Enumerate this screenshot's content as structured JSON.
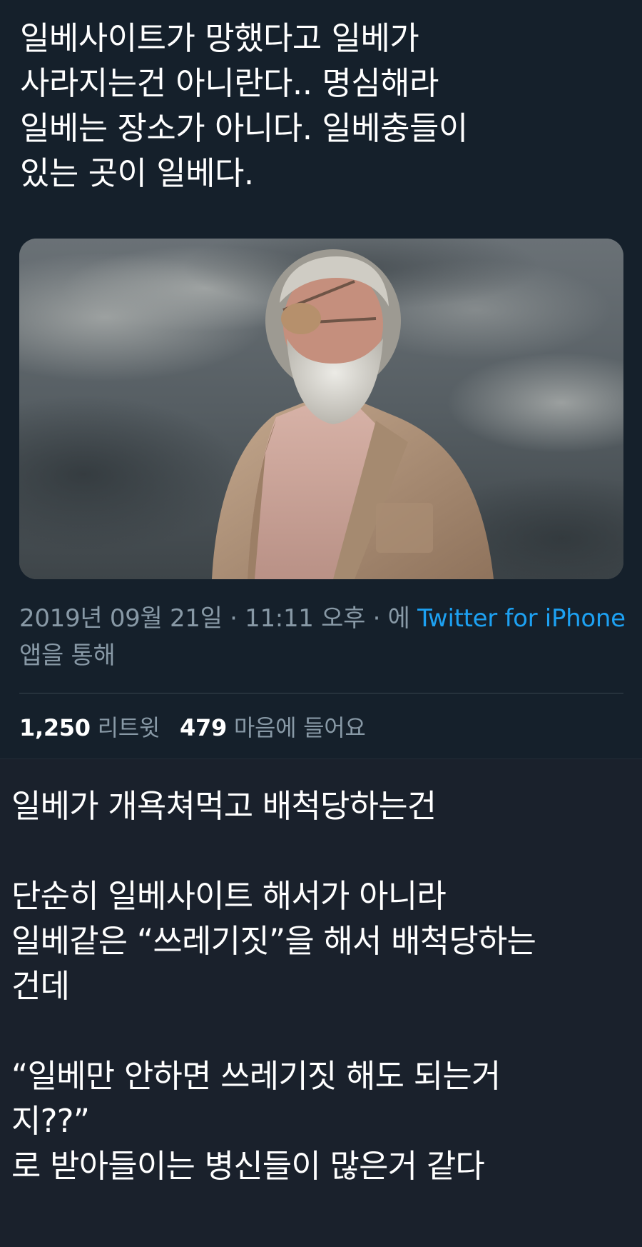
{
  "tweet": {
    "text": "일베사이트가 망했다고 일베가\n사라지는건 아니란다.. 명심해라\n일베는 장소가 아니다. 일베충들이\n있는 곳이 일베다.",
    "media": {
      "icon": "photo-attachment"
    },
    "meta": {
      "timestamp": "2019년 09월 21일 · 11:11 오후 · 에 ",
      "source_link": "Twitter for iPhone",
      "suffix": " 앱을 통해"
    },
    "stats": {
      "retweet_count": "1,250",
      "retweet_label": "리트윗",
      "like_count": "479",
      "like_label": "마음에 들어요"
    }
  },
  "comment": {
    "line1": "일베가 개욕쳐먹고 배척당하는건",
    "line2": "단순히 일베사이트 해서가 아니라\n일베같은 “쓰레기짓”을 해서 배척당하는\n건데",
    "line3": "“일베만 안하면 쓰레기짓 해도 되는거\n지??”\n로 받아들이는 병신들이 많은거 같다"
  },
  "colors": {
    "background": "#15202b",
    "comment_background": "#1a212c",
    "link": "#1da1f2",
    "secondary_text": "#8899a6"
  }
}
